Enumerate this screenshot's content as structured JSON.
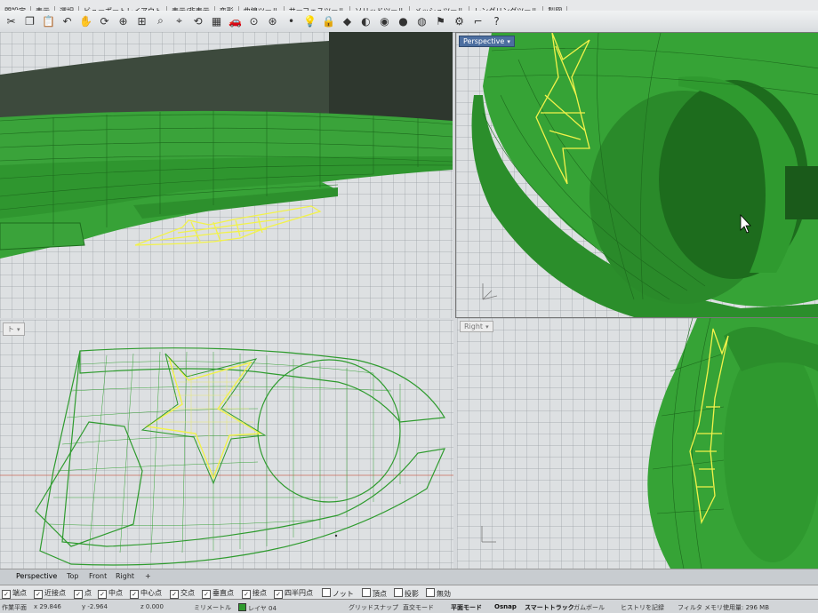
{
  "menu": [
    "間設定",
    "表示",
    "選択",
    "ビューポートレイアウト",
    "表示/非表示",
    "変形",
    "曲線ツール",
    "サーフェスツール",
    "ソリッドツール",
    "メッシュツール",
    "レンダリングツール",
    "製図"
  ],
  "toolbar_icons": [
    "cut-icon",
    "copy-icon",
    "paste-icon",
    "undo-icon",
    "pan-icon",
    "rotate-icon",
    "zoom-icon",
    "zoom-window-icon",
    "zoom-extents-icon",
    "zoom-selected-icon",
    "undo-view-icon",
    "viewport-layout-icon",
    "car-icon",
    "select-icon",
    "object-properties-icon",
    "point-icon",
    "light-icon",
    "lock-icon",
    "shade-icon",
    "material-icon",
    "rendered-icon",
    "render-icon",
    "rendering-sphere-icon",
    "flag-icon",
    "options-icon",
    "dimension-icon",
    "help-icon"
  ],
  "viewports": {
    "top_left": {
      "label": ""
    },
    "top_right": {
      "label": "Perspective",
      "axis": "z x y"
    },
    "bottom_left": {
      "label": "ト"
    },
    "bottom_right": {
      "label": "Right",
      "axis": "z y"
    }
  },
  "view_tabs": [
    "Perspective",
    "Top",
    "Front",
    "Right"
  ],
  "osnap": [
    {
      "label": "端点",
      "checked": true
    },
    {
      "label": "近接点",
      "checked": true
    },
    {
      "label": "点",
      "checked": true
    },
    {
      "label": "中点",
      "checked": true
    },
    {
      "label": "中心点",
      "checked": true
    },
    {
      "label": "交点",
      "checked": true
    },
    {
      "label": "垂直点",
      "checked": true
    },
    {
      "label": "接点",
      "checked": true
    },
    {
      "label": "四半円点",
      "checked": true
    },
    {
      "label": "ノット",
      "checked": false
    },
    {
      "label": "頂点",
      "checked": false
    },
    {
      "label": "投影",
      "checked": false
    },
    {
      "label": "無効",
      "checked": false
    }
  ],
  "status": {
    "plane": "作業平面",
    "x": "x 29.846",
    "y": "y -2.964",
    "z": "z 0.000",
    "units": "ミリメートル",
    "layer": "レイヤ 04",
    "grid_snap": "グリッドスナップ",
    "ortho": "直交モード",
    "planar": "平面モード",
    "osnap": "Osnap",
    "smarttrack": "スマートトラック",
    "gumball": "ガムボール",
    "history": "ヒストリを記録",
    "filter": "フィルタ",
    "memory": "メモリ使用量: 296 MB"
  },
  "colors": {
    "model_green": "#35a835",
    "wire_dark": "#1e6e1e",
    "star_yellow": "#f2f24a",
    "viewport_bg": "#dde0e2",
    "active_label": "#4c6ea0"
  }
}
